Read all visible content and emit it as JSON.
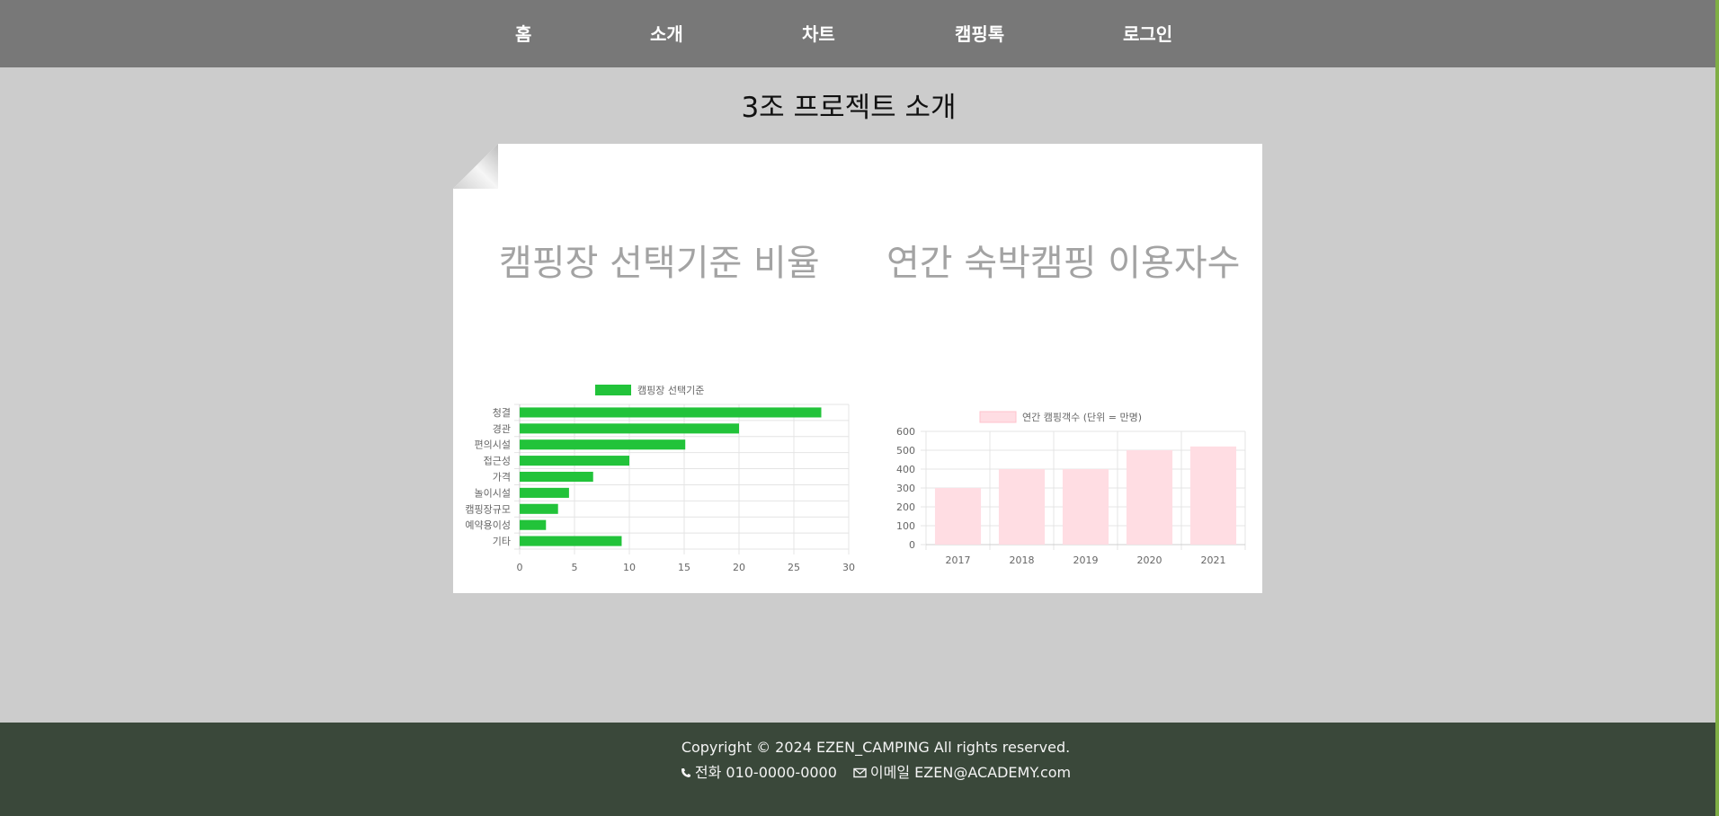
{
  "nav": {
    "items": [
      {
        "label": "홈"
      },
      {
        "label": "소개"
      },
      {
        "label": "차트"
      },
      {
        "label": "캠핑톡"
      },
      {
        "label": "로그인"
      }
    ]
  },
  "page": {
    "title": "3조 프로젝트 소개"
  },
  "charts": {
    "left_heading": "캠핑장 선택기준 비율",
    "right_heading": "연간 숙박캠핑 이용자수"
  },
  "chart_data": [
    {
      "type": "bar",
      "orientation": "horizontal",
      "legend": "캠핑장 선택기준",
      "legend_placement": "top",
      "color": "#22c33a",
      "categories": [
        "청결",
        "경관",
        "편의시설",
        "접근성",
        "가격",
        "놀이시설",
        "캠핑장규모",
        "예약용이성",
        "기타"
      ],
      "values": [
        27.5,
        20,
        15.1,
        10,
        6.7,
        4.5,
        3.5,
        2.4,
        9.3
      ],
      "xlim": [
        0,
        30
      ],
      "xticks": [
        "0",
        "5",
        "10",
        "15",
        "20",
        "25",
        "30"
      ],
      "grid": true
    },
    {
      "type": "bar",
      "legend": "연간 캠핑객수 (단위 = 만명)",
      "legend_placement": "top",
      "color": "#ffdde3",
      "border_color": "#ffc3cc",
      "categories": [
        "2017",
        "2018",
        "2019",
        "2020",
        "2021"
      ],
      "values": [
        300,
        400,
        400,
        500,
        520
      ],
      "ylim": [
        0,
        600
      ],
      "yticks": [
        "0",
        "100",
        "200",
        "300",
        "400",
        "500",
        "600"
      ],
      "grid": true
    }
  ],
  "footer": {
    "copyright": "Copyright © 2024 EZEN_CAMPING All rights reserved.",
    "phone": "전화 010-0000-0000",
    "email": "이메일 EZEN@ACADEMY.com",
    "phone_icon": "phone-icon",
    "email_icon": "mail-icon"
  },
  "colors": {
    "nav_bg": "#787878",
    "page_bg": "#cccccc",
    "footer_bg": "#3a483a",
    "heading_gray": "#a3a3a3"
  }
}
